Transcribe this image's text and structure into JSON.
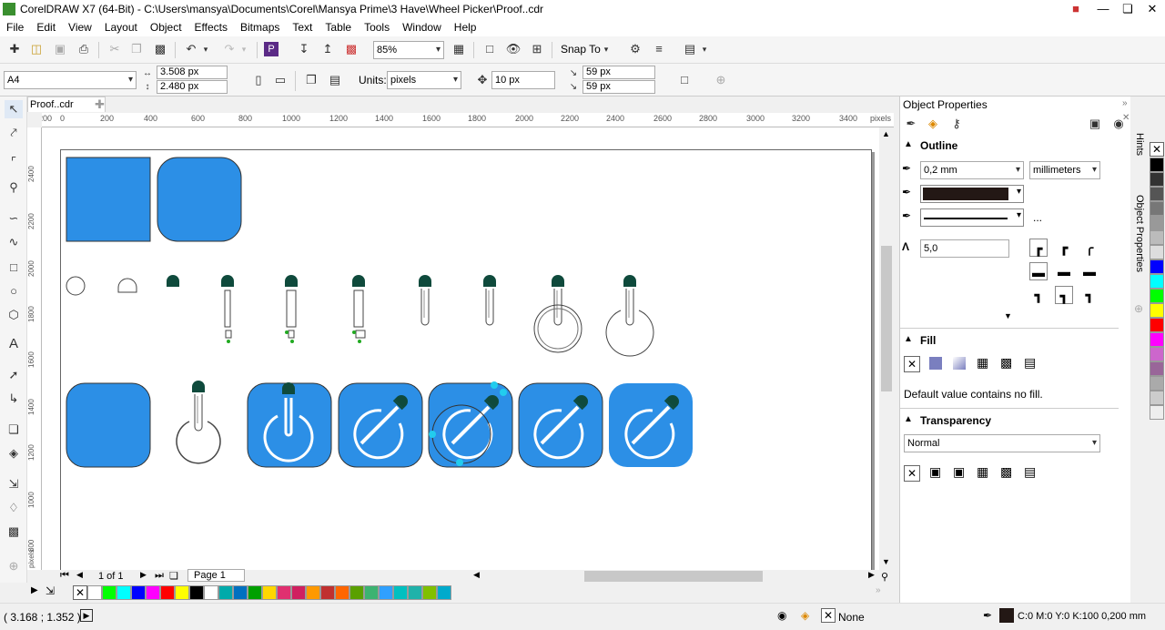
{
  "window": {
    "title": "CorelDRAW X7 (64-Bit) - C:\\Users\\mansya\\Documents\\Corel\\Mansya Prime\\3 Have\\Wheel Picker\\Proof..cdr"
  },
  "menu": [
    "File",
    "Edit",
    "View",
    "Layout",
    "Object",
    "Effects",
    "Bitmaps",
    "Text",
    "Table",
    "Tools",
    "Window",
    "Help"
  ],
  "toolbar": {
    "zoom": "85%",
    "snap_to": "Snap To"
  },
  "propbar": {
    "page_size": "A4",
    "width": "3.508 px",
    "height": "2.480 px",
    "units_label": "Units:",
    "units": "pixels",
    "nudge": "10 px",
    "dup_x": "59 px",
    "dup_y": "59 px"
  },
  "doc": {
    "tab": "Proof..cdr",
    "page_nav": "1 of 1",
    "page_tab": "Page 1"
  },
  "ruler_h": [
    "200",
    "0",
    "200",
    "400",
    "600",
    "800",
    "1000",
    "1200",
    "1400",
    "1600",
    "1800",
    "2000",
    "2200",
    "2400",
    "2600",
    "2800",
    "3000",
    "3200",
    "3400",
    "pixels"
  ],
  "ruler_v": [
    "2400",
    "2200",
    "2000",
    "1800",
    "1600",
    "1400",
    "1200",
    "1000",
    "800",
    "pixels"
  ],
  "status": {
    "coords": "( 3.168 ; 1.352 )",
    "fill": "None",
    "outline": "C:0 M:0 Y:0 K:100  0,200 mm"
  },
  "panel": {
    "title": "Object Properties",
    "outline": {
      "heading": "Outline",
      "width": "0,2 mm",
      "unit": "millimeters",
      "miter": "5,0",
      "more": "..."
    },
    "fill": {
      "heading": "Fill",
      "note": "Default value contains no fill."
    },
    "transparency": {
      "heading": "Transparency",
      "mode": "Normal"
    }
  },
  "side_tabs": {
    "hints": "Hints",
    "object_properties": "Object Properties"
  },
  "colors": {
    "accent": "#2c8fe6",
    "pipette": "#0f4a3c",
    "doc_palette": [
      "#ffffff",
      "#00ff00",
      "#00ffff",
      "#0000ff",
      "#ff00ff",
      "#ff0000",
      "#ffff00",
      "#000000",
      "#ffffff",
      "#00aaaa",
      "#0070c0",
      "#00a000",
      "#ffd700",
      "#e03070",
      "#d02060",
      "#ff9900",
      "#c03030",
      "#ff6600",
      "#5aa000",
      "#3cb371",
      "#30a0ff",
      "#00c0c0",
      "#20b2aa",
      "#80c000",
      "#00aacc"
    ],
    "right_palette": [
      "#000000",
      "#333333",
      "#555555",
      "#777777",
      "#999999",
      "#bbbbbb",
      "#dddddd",
      "#0000ff",
      "#00ffff",
      "#00ff00",
      "#ffff00",
      "#ff0000",
      "#ff00ff",
      "#cc66cc",
      "#996699",
      "#aaaaaa",
      "#cccccc",
      "#eeeeee"
    ]
  }
}
